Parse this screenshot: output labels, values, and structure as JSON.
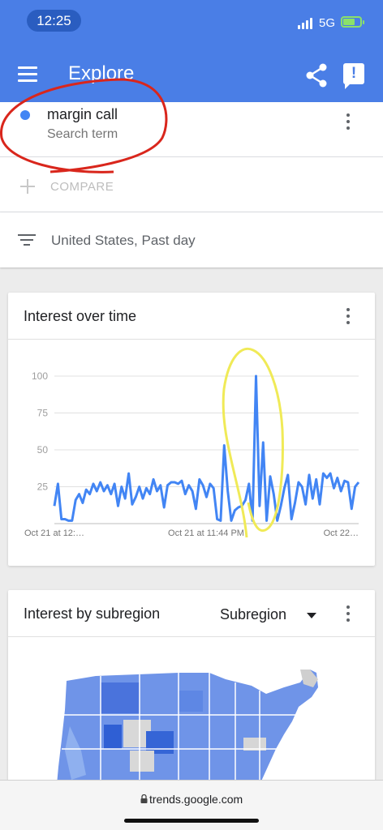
{
  "status_bar": {
    "time": "12:25",
    "network": "5G"
  },
  "app_bar": {
    "title": "Explore",
    "menu_icon": "menu-icon",
    "share_icon": "share-icon",
    "feedback_icon": "feedback-icon"
  },
  "search_term": {
    "title": "margin call",
    "subtitle": "Search term",
    "color": "#4285f4"
  },
  "compare": {
    "label": "COMPARE"
  },
  "filter": {
    "label": "United States, Past day"
  },
  "interest_over_time": {
    "title": "Interest over time",
    "chart_data": {
      "type": "line",
      "title": "",
      "xlabel": "",
      "ylabel": "",
      "ylim": [
        0,
        100
      ],
      "yticks": [
        "100",
        "75",
        "50",
        "25"
      ],
      "x_tick_labels": [
        "Oct 21 at 12:…",
        "Oct 21 at 11:44 PM",
        "Oct 22…"
      ],
      "grid": true,
      "color": "#4285f4",
      "series": [
        {
          "values": [
            12,
            27,
            3,
            3,
            2,
            2,
            16,
            20,
            14,
            23,
            20,
            27,
            22,
            28,
            22,
            26,
            20,
            27,
            12,
            25,
            17,
            34,
            13,
            18,
            25,
            17,
            24,
            20,
            30,
            22,
            26,
            11,
            26,
            28,
            28,
            27,
            29,
            20,
            26,
            22,
            10,
            30,
            26,
            18,
            27,
            24,
            3,
            2,
            53,
            22,
            2,
            9,
            11,
            12,
            16,
            27,
            2,
            100,
            12,
            55,
            2,
            32,
            20,
            2,
            12,
            24,
            33,
            3,
            14,
            28,
            25,
            13,
            33,
            17,
            30,
            13,
            34,
            31,
            34,
            24,
            31,
            22,
            29,
            28,
            10,
            25,
            28
          ]
        }
      ]
    }
  },
  "interest_by_subregion": {
    "title": "Interest by subregion",
    "dropdown": "Subregion"
  },
  "url_bar": {
    "url": "trends.google.com"
  }
}
